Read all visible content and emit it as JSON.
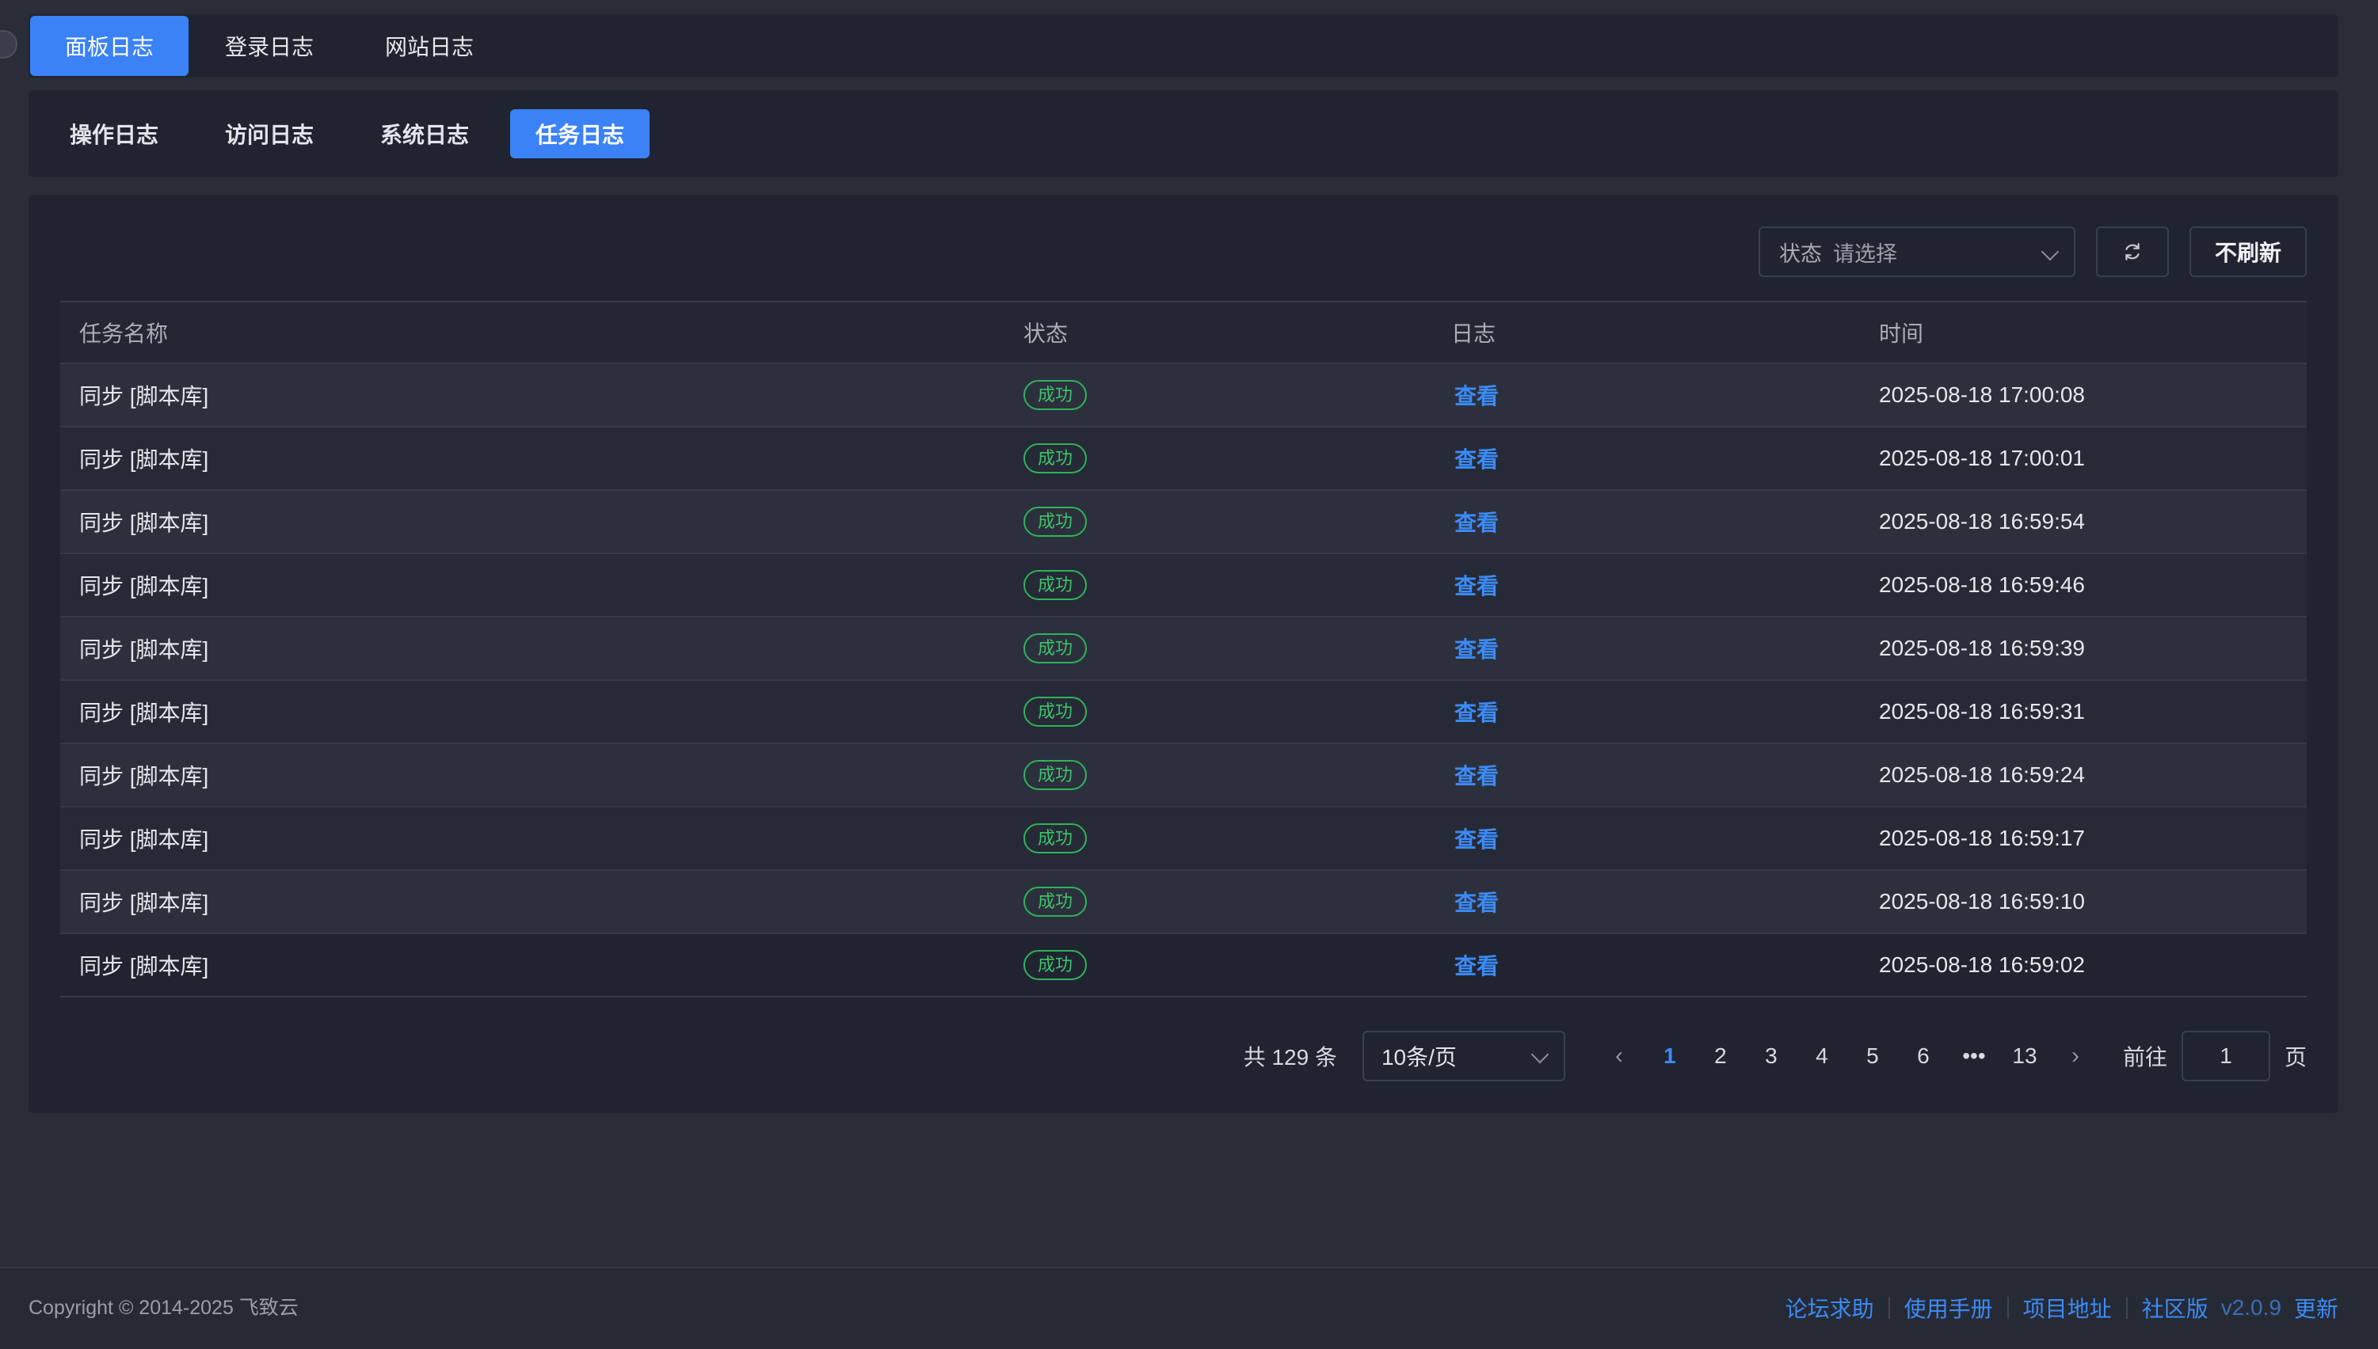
{
  "top_tabs": [
    {
      "label": "面板日志",
      "active": true
    },
    {
      "label": "登录日志",
      "active": false
    },
    {
      "label": "网站日志",
      "active": false
    }
  ],
  "sub_tabs": [
    {
      "label": "操作日志",
      "active": false
    },
    {
      "label": "访问日志",
      "active": false
    },
    {
      "label": "系统日志",
      "active": false
    },
    {
      "label": "任务日志",
      "active": true
    }
  ],
  "toolbar": {
    "status_label": "状态",
    "status_placeholder": "请选择",
    "no_refresh_label": "不刷新"
  },
  "table": {
    "headers": [
      "任务名称",
      "状态",
      "日志",
      "时间"
    ],
    "rows": [
      {
        "name": "同步 [脚本库]",
        "status": "成功",
        "log": "查看",
        "time": "2025-08-18 17:00:08"
      },
      {
        "name": "同步 [脚本库]",
        "status": "成功",
        "log": "查看",
        "time": "2025-08-18 17:00:01"
      },
      {
        "name": "同步 [脚本库]",
        "status": "成功",
        "log": "查看",
        "time": "2025-08-18 16:59:54"
      },
      {
        "name": "同步 [脚本库]",
        "status": "成功",
        "log": "查看",
        "time": "2025-08-18 16:59:46"
      },
      {
        "name": "同步 [脚本库]",
        "status": "成功",
        "log": "查看",
        "time": "2025-08-18 16:59:39"
      },
      {
        "name": "同步 [脚本库]",
        "status": "成功",
        "log": "查看",
        "time": "2025-08-18 16:59:31"
      },
      {
        "name": "同步 [脚本库]",
        "status": "成功",
        "log": "查看",
        "time": "2025-08-18 16:59:24"
      },
      {
        "name": "同步 [脚本库]",
        "status": "成功",
        "log": "查看",
        "time": "2025-08-18 16:59:17"
      },
      {
        "name": "同步 [脚本库]",
        "status": "成功",
        "log": "查看",
        "time": "2025-08-18 16:59:10"
      },
      {
        "name": "同步 [脚本库]",
        "status": "成功",
        "log": "查看",
        "time": "2025-08-18 16:59:02"
      }
    ]
  },
  "pagination": {
    "total_text": "共 129 条",
    "page_size": "10条/页",
    "pages": [
      "1",
      "2",
      "3",
      "4",
      "5",
      "6",
      "•••",
      "13"
    ],
    "current_page": "1",
    "goto_label": "前往",
    "goto_value": "1",
    "page_suffix": "页"
  },
  "footer": {
    "copyright": "Copyright © 2014-2025 飞致云",
    "links": [
      "论坛求助",
      "使用手册",
      "项目地址",
      "社区版"
    ],
    "version": "v2.0.9",
    "update_label": "更新"
  },
  "colors": {
    "accent": "#3b82f6",
    "success": "#3ec26a",
    "link": "#3b8bf7",
    "background": "#2a2d38",
    "panel": "#202431"
  }
}
